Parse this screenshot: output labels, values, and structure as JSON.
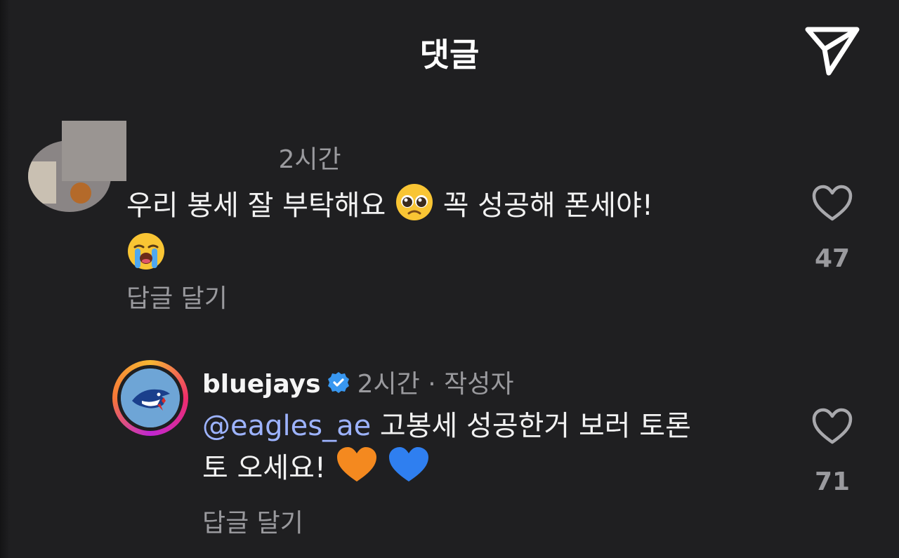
{
  "header": {
    "title": "댓글",
    "send_icon": "paper-plane-icon"
  },
  "comments": [
    {
      "username": "",
      "time": "2시간",
      "text_before_emoji": "우리 봉세 잘 부탁해요",
      "text_after_emoji": "꼭 성공해 폰세야!",
      "emojis": [
        "pleading-face-emoji",
        "loudly-crying-face-emoji"
      ],
      "reply_label": "답글 달기",
      "likes": "47"
    },
    {
      "username": "bluejays",
      "verified": true,
      "time": "2시간",
      "author_label": "· 작성자",
      "mention": "@eagles_ae",
      "text_line1": "고봉세 성공한거 보러 토론",
      "text_line2": "토 오세요!",
      "emojis": [
        "orange-heart-emoji",
        "blue-heart-emoji"
      ],
      "reply_label": "답글 달기",
      "likes": "71"
    }
  ],
  "colors": {
    "background": "#1f1f21",
    "text": "#f5f5f5",
    "muted": "#9a9a9e",
    "mention": "#9db3ff",
    "verified": "#3897f0"
  }
}
